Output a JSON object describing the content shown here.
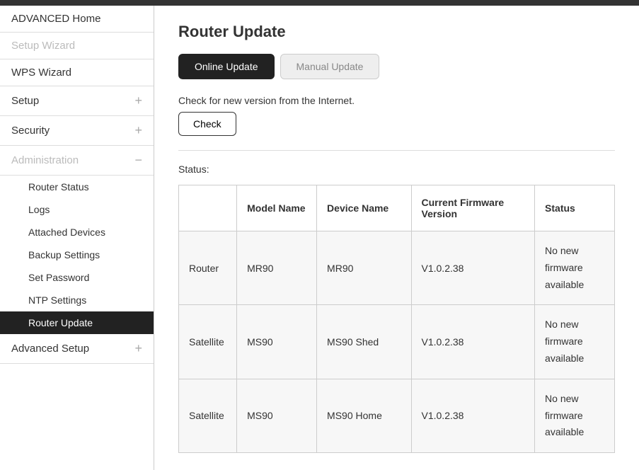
{
  "sidebar": {
    "items": [
      {
        "label": "ADVANCED Home",
        "type": "item",
        "active": false
      },
      {
        "label": "Setup Wizard",
        "type": "item",
        "disabled": true
      },
      {
        "label": "WPS Wizard",
        "type": "item"
      },
      {
        "label": "Setup",
        "type": "expand",
        "icon": "plus"
      },
      {
        "label": "Security",
        "type": "expand",
        "icon": "plus"
      },
      {
        "label": "Administration",
        "type": "expand",
        "icon": "minus",
        "disabled": true
      },
      {
        "label": "Advanced Setup",
        "type": "expand",
        "icon": "plus"
      }
    ],
    "adminSubitems": [
      {
        "label": "Router Status"
      },
      {
        "label": "Logs"
      },
      {
        "label": "Attached Devices"
      },
      {
        "label": "Backup Settings"
      },
      {
        "label": "Set Password"
      },
      {
        "label": "NTP Settings"
      },
      {
        "label": "Router Update",
        "active": true
      }
    ]
  },
  "main": {
    "title": "Router Update",
    "tabs": [
      {
        "label": "Online Update",
        "active": true
      },
      {
        "label": "Manual Update",
        "active": false
      }
    ],
    "check": {
      "text": "Check for new version from the Internet.",
      "button": "Check"
    },
    "statusLabel": "Status:",
    "table": {
      "headers": [
        "",
        "Model Name",
        "Device Name",
        "Current Firmware Version",
        "Status"
      ],
      "rows": [
        {
          "type": "Router",
          "model": "MR90",
          "device": "MR90",
          "version": "V1.0.2.38",
          "status": "No new firmware available"
        },
        {
          "type": "Satellite",
          "model": "MS90",
          "device": "MS90 Shed",
          "version": "V1.0.2.38",
          "status": "No new firmware available"
        },
        {
          "type": "Satellite",
          "model": "MS90",
          "device": "MS90 Home",
          "version": "V1.0.2.38",
          "status": "No new firmware available"
        }
      ]
    }
  },
  "icons": {
    "plus": "+",
    "minus": "−"
  }
}
